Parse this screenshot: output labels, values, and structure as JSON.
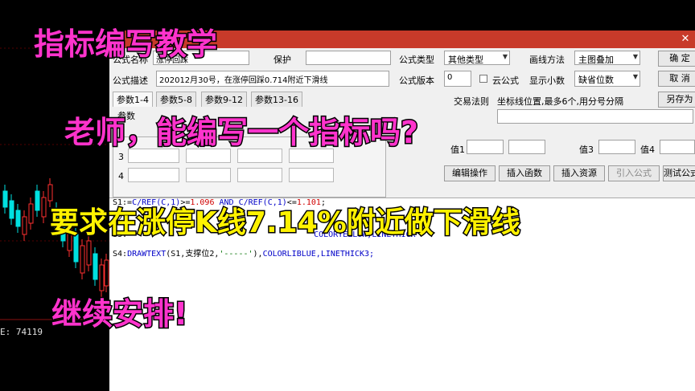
{
  "left_chart": {
    "price_readout": "E: 74119"
  },
  "form": {
    "row1": {
      "name_label": "公式名称",
      "name_value": "涨停回踩",
      "protect_label": "保护",
      "type_label": "公式类型",
      "type_value": "其他类型",
      "draw_label": "画线方法",
      "draw_value": "主图叠加",
      "ok_label": "确 定"
    },
    "row2": {
      "desc_label": "公式描述",
      "desc_value": "202012月30号，在涨停回踩0.714附近下滑线",
      "version_label": "公式版本",
      "version_value": "0",
      "cloud_label": "云公式",
      "decimals_label": "显示小数",
      "decimals_value": "缺省位数",
      "cancel_label": "取 消"
    },
    "row3": {
      "tabs": [
        "参数1-4",
        "参数5-8",
        "参数9-12",
        "参数13-16"
      ],
      "trade_rule": "交易法则",
      "coord_hint": "坐标线位置,最多6个,用分号分隔",
      "saveas_label": "另存为"
    },
    "params": {
      "header": "参数",
      "rows": [
        "3",
        "4"
      ]
    },
    "values": {
      "v1": "值1",
      "v2": "值2",
      "v3": "值3",
      "v4": "值4"
    },
    "buttons": {
      "edit": "编辑操作",
      "insert_fn": "插入函数",
      "insert_res": "插入资源",
      "import": "引入公式",
      "test": "测试公式"
    }
  },
  "code": {
    "s1": {
      "a": "S1:=",
      "b": "C/REF(C,1)",
      "c": ">=",
      "d": "1.096",
      "e": " AND ",
      "f": "C/REF(C,1)",
      "g": "<=",
      "h": "1.101",
      "i": ";"
    },
    "s2": "S2:",
    "s3": {
      "a": "S3:",
      "b": "COLORYELLOW",
      "c": ",LINETHICK"
    },
    "s4": {
      "a": "S4:",
      "b": "DRAWTEXT",
      "c": "(S1,支撑位2,",
      "d": "'-----'",
      "e": "),",
      "f": "COLORLIBLUE",
      "g": ",LINETHICK3;"
    }
  },
  "overlay": {
    "line1": "指标编写教学",
    "line2": "老师，能编写一个指标吗?",
    "line3": "要求在涨停K线7.14%附近做下滑线",
    "line4": "继续安排!"
  },
  "colors": {
    "title_bar": "#c83a2a",
    "overlay_magenta": "#ff33cc",
    "overlay_yellow": "#fff200",
    "candle_up": "#ff3030",
    "candle_down": "#00e0e0"
  }
}
